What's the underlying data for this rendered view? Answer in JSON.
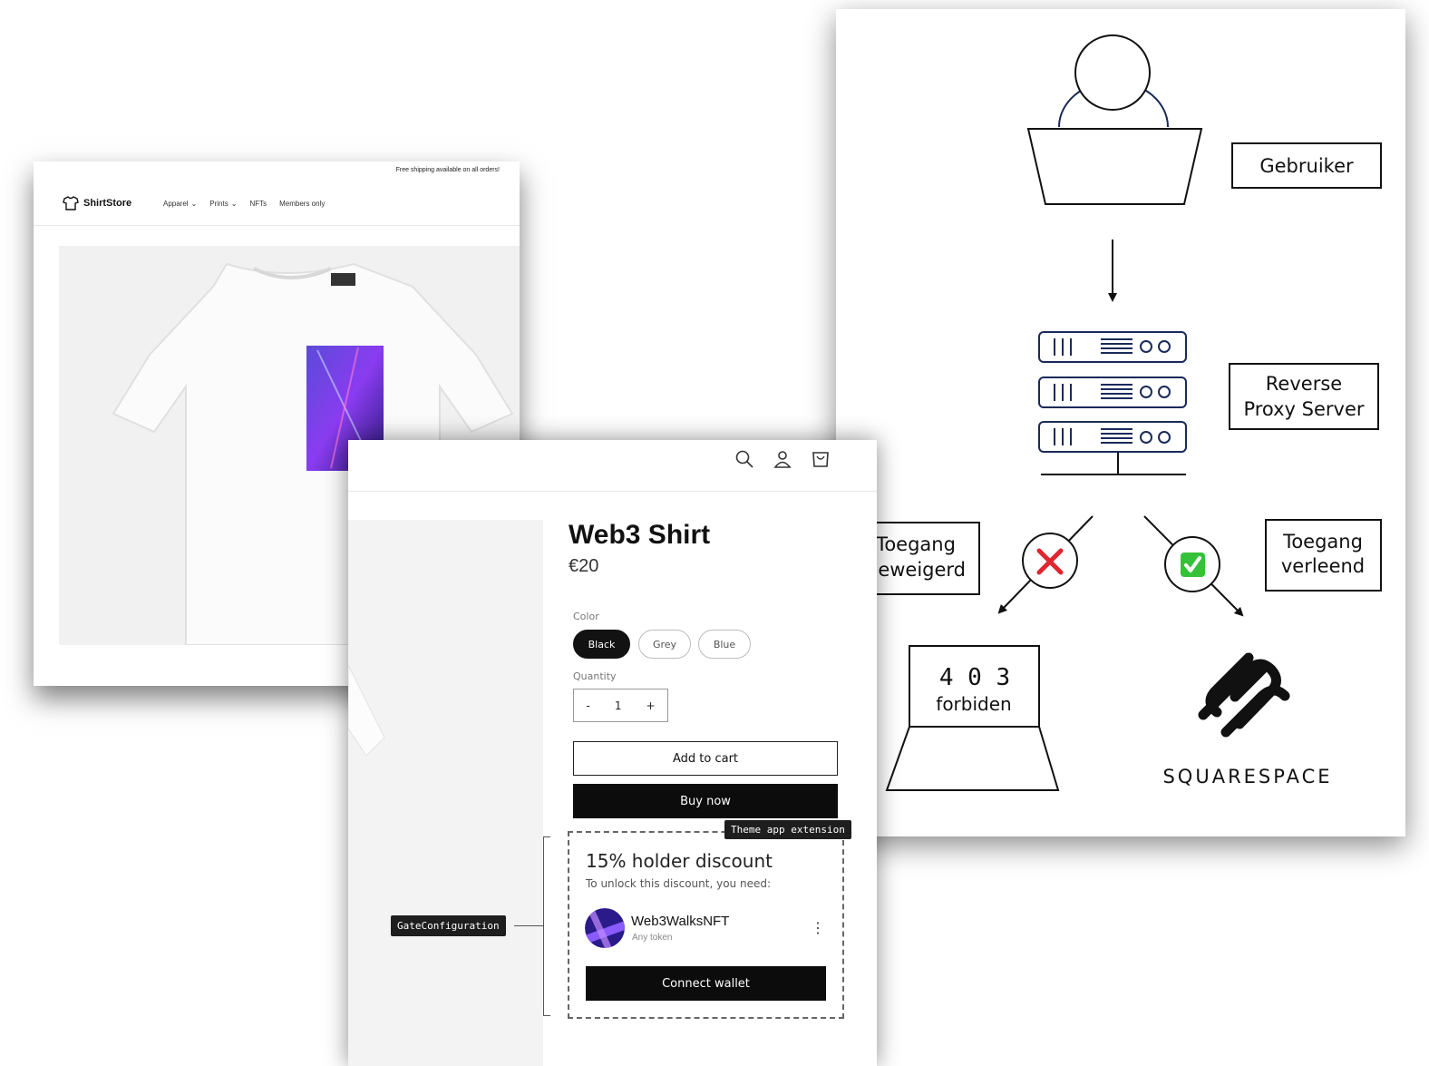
{
  "diagram": {
    "labels": {
      "user": "Gebruiker",
      "proxy_line1": "Reverse",
      "proxy_line2": "Proxy Server",
      "denied_line1": "Toegang",
      "denied_line2": "geweigerd",
      "granted_line1": "Toegang",
      "granted_line2": "verleend",
      "error_code": "4 0 3",
      "error_text": "forbiden",
      "brand": "SQUARESPACE"
    },
    "icons": {
      "denied": "red-x-icon",
      "granted": "green-check-icon"
    },
    "colors": {
      "denied": "#e0262e",
      "granted": "#35c23a"
    }
  },
  "store": {
    "announcement": "Free shipping available on all orders!",
    "brand": "ShirtStore",
    "nav": [
      "Apparel",
      "Prints",
      "NFTs",
      "Members only"
    ]
  },
  "product": {
    "title": "Web3 Shirt",
    "price": "€20",
    "color_label": "Color",
    "colors": [
      "Black",
      "Grey",
      "Blue"
    ],
    "selected_color": "Black",
    "quantity_label": "Quantity",
    "quantity": "1",
    "minus": "-",
    "plus": "+",
    "add_to_cart": "Add to cart",
    "buy_now": "Buy now"
  },
  "extension": {
    "tag": "Theme app extension",
    "title": "15% holder discount",
    "subtitle": "To unlock this discount, you need:",
    "nft_name": "Web3WalksNFT",
    "nft_sub": "Any token",
    "connect": "Connect wallet",
    "menu": "⋮"
  },
  "gate_tag": "GateConfiguration"
}
